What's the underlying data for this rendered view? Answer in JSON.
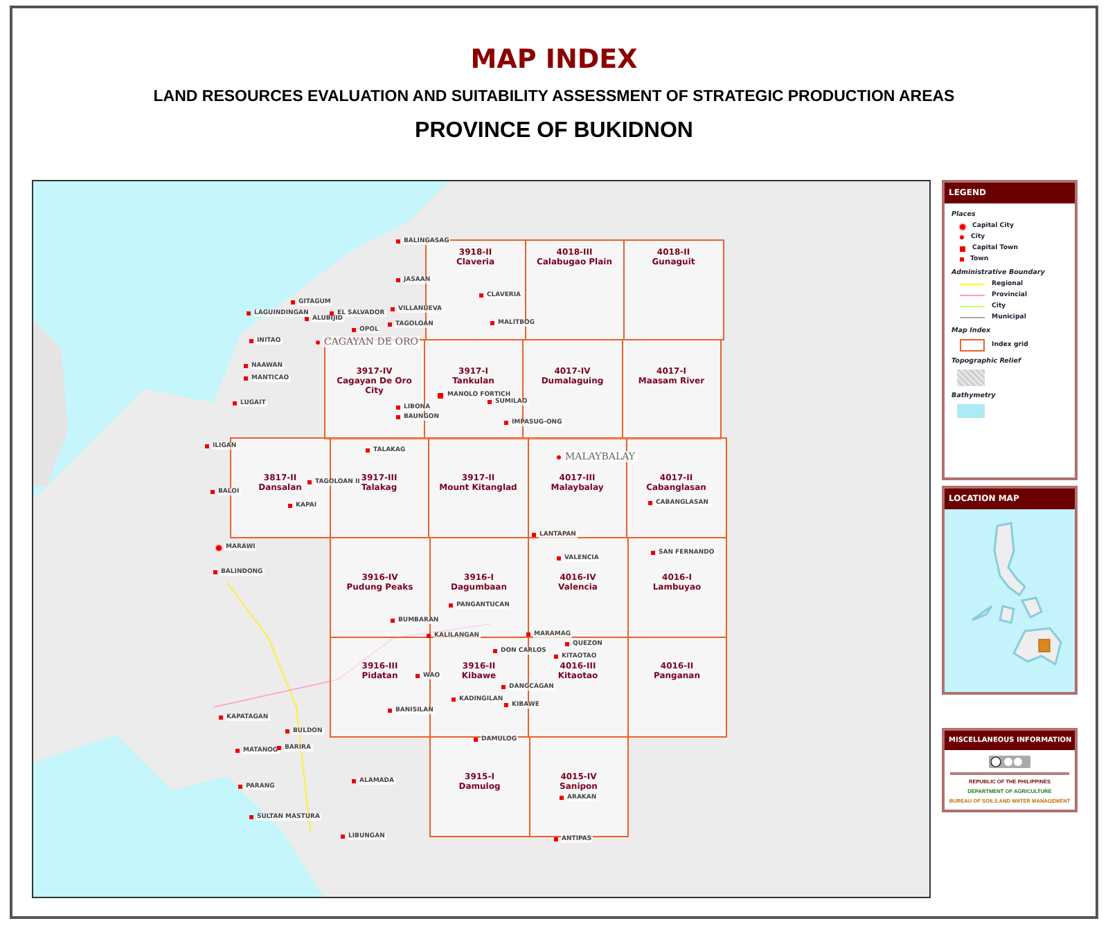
{
  "header": {
    "title": "MAP INDEX",
    "subtitle": "LAND RESOURCES EVALUATION AND SUITABILITY ASSESSMENT OF STRATEGIC PRODUCTION AREAS",
    "province": "PROVINCE OF BUKIDNON"
  },
  "index_grid": [
    {
      "cells": [
        {
          "code": "3918-II",
          "name": "Claveria"
        },
        {
          "code": "4018-III",
          "name": "Calabugao Plain"
        },
        {
          "code": "4018-II",
          "name": "Gunaguit"
        }
      ]
    },
    {
      "cells": [
        {
          "code": "3917-IV",
          "name": "Cagayan De Oro City"
        },
        {
          "code": "3917-I",
          "name": "Tankulan"
        },
        {
          "code": "4017-IV",
          "name": "Dumalaguing"
        },
        {
          "code": "4017-I",
          "name": "Maasam River"
        }
      ]
    },
    {
      "cells": [
        {
          "code": "3817-II",
          "name": "Dansalan"
        },
        {
          "code": "3917-III",
          "name": "Talakag"
        },
        {
          "code": "3917-II",
          "name": "Mount Kitanglad"
        },
        {
          "code": "4017-III",
          "name": "Malaybalay"
        },
        {
          "code": "4017-II",
          "name": "Cabanglasan"
        }
      ]
    },
    {
      "cells": [
        {
          "code": "3916-IV",
          "name": "Pudung Peaks"
        },
        {
          "code": "3916-I",
          "name": "Dagumbaan"
        },
        {
          "code": "4016-IV",
          "name": "Valencia"
        },
        {
          "code": "4016-I",
          "name": "Lambuyao"
        }
      ]
    },
    {
      "cells": [
        {
          "code": "3916-III",
          "name": "Pidatan"
        },
        {
          "code": "3916-II",
          "name": "Kibawe"
        },
        {
          "code": "4016-III",
          "name": "Kitaotao"
        },
        {
          "code": "4016-II",
          "name": "Panganan"
        }
      ]
    },
    {
      "cells": [
        {
          "code": "3915-I",
          "name": "Damulog"
        },
        {
          "code": "4015-IV",
          "name": "Sanipon"
        }
      ]
    }
  ],
  "places": [
    {
      "name": "BALINGASAG",
      "kind": "town"
    },
    {
      "name": "JASAAN",
      "kind": "town"
    },
    {
      "name": "VILLANUEVA",
      "kind": "town"
    },
    {
      "name": "TAGOLOAN",
      "kind": "town"
    },
    {
      "name": "CLAVERIA",
      "kind": "town"
    },
    {
      "name": "MALITBOG",
      "kind": "town"
    },
    {
      "name": "EL SALVADOR",
      "kind": "town"
    },
    {
      "name": "OPOL",
      "kind": "town"
    },
    {
      "name": "CAGAYAN DE ORO",
      "kind": "city"
    },
    {
      "name": "LIBONA",
      "kind": "town"
    },
    {
      "name": "BAUNGON",
      "kind": "town"
    },
    {
      "name": "MANOLO FORTICH",
      "kind": "capital_town"
    },
    {
      "name": "SUMILAO",
      "kind": "town"
    },
    {
      "name": "IMPASUG-ONG",
      "kind": "town"
    },
    {
      "name": "TALAKAG",
      "kind": "town"
    },
    {
      "name": "TAGOLOAN II",
      "kind": "town"
    },
    {
      "name": "KAPAI",
      "kind": "town"
    },
    {
      "name": "MALAYBALAY",
      "kind": "city"
    },
    {
      "name": "CABANGLASAN",
      "kind": "town"
    },
    {
      "name": "LANTAPAN",
      "kind": "town"
    },
    {
      "name": "VALENCIA",
      "kind": "town"
    },
    {
      "name": "SAN FERNANDO",
      "kind": "town"
    },
    {
      "name": "PANGANTUCAN",
      "kind": "town"
    },
    {
      "name": "BUMBARAN",
      "kind": "town"
    },
    {
      "name": "KALILANGAN",
      "kind": "town"
    },
    {
      "name": "MARAMAG",
      "kind": "town"
    },
    {
      "name": "QUEZON",
      "kind": "town"
    },
    {
      "name": "DON CARLOS",
      "kind": "town"
    },
    {
      "name": "KITAOTAO",
      "kind": "town"
    },
    {
      "name": "DANGCAGAN",
      "kind": "town"
    },
    {
      "name": "KADINGILAN",
      "kind": "town"
    },
    {
      "name": "KIBAWE",
      "kind": "town"
    },
    {
      "name": "WAO",
      "kind": "town"
    },
    {
      "name": "BANISILAN",
      "kind": "town"
    },
    {
      "name": "DAMULOG",
      "kind": "town"
    },
    {
      "name": "ARAKAN",
      "kind": "town"
    },
    {
      "name": "ANTIPAS",
      "kind": "town"
    },
    {
      "name": "ALAMADA",
      "kind": "town"
    },
    {
      "name": "LIBUNGAN",
      "kind": "town"
    },
    {
      "name": "GITAGUM",
      "kind": "town"
    },
    {
      "name": "LAGUINDINGAN",
      "kind": "town"
    },
    {
      "name": "ALUBIJID",
      "kind": "town"
    },
    {
      "name": "INITAO",
      "kind": "town"
    },
    {
      "name": "NAAWAN",
      "kind": "town"
    },
    {
      "name": "MANTICAO",
      "kind": "town"
    },
    {
      "name": "LUGAIT",
      "kind": "town"
    },
    {
      "name": "ILIGAN",
      "kind": "town"
    },
    {
      "name": "BALOI",
      "kind": "town"
    },
    {
      "name": "MARAWI",
      "kind": "capital_city"
    },
    {
      "name": "BALINDONG",
      "kind": "town"
    },
    {
      "name": "KAPATAGAN",
      "kind": "town"
    },
    {
      "name": "BULDON",
      "kind": "town"
    },
    {
      "name": "MATANOG",
      "kind": "town"
    },
    {
      "name": "BARIRA",
      "kind": "town"
    },
    {
      "name": "PARANG",
      "kind": "town"
    },
    {
      "name": "SULTAN MASTURA",
      "kind": "town"
    }
  ],
  "legend": {
    "title": "LEGEND",
    "places_heading": "Places",
    "places": [
      {
        "label": "Capital City",
        "kind": "capital_city"
      },
      {
        "label": "City",
        "kind": "city"
      },
      {
        "label": "Capital Town",
        "kind": "capital_town"
      },
      {
        "label": "Town",
        "kind": "town"
      }
    ],
    "boundary_heading": "Administrative Boundary",
    "boundaries": [
      {
        "label": "Regional",
        "color": "#ffff00"
      },
      {
        "label": "Provincial",
        "color": "#ff99cc"
      },
      {
        "label": "City",
        "color": "#ccff66"
      },
      {
        "label": "Municipal",
        "color": "#aaaaaa"
      }
    ],
    "index_heading": "Map Index",
    "index_label": "Index grid",
    "relief_heading": "Topographic Relief",
    "bathymetry_heading": "Bathymetry"
  },
  "location_map": {
    "title": "LOCATION MAP"
  },
  "misc": {
    "title": "MISCELLANEOUS INFORMATION",
    "agency_lines": [
      {
        "text": "REPUBLIC OF THE PHILIPPINES",
        "color": "#7a0000"
      },
      {
        "text": "DEPARTMENT OF AGRICULTURE",
        "color": "#1a7a1a"
      },
      {
        "text": "BUREAU OF SOILS AND WATER MANAGEMENT",
        "color": "#c07000"
      }
    ]
  }
}
